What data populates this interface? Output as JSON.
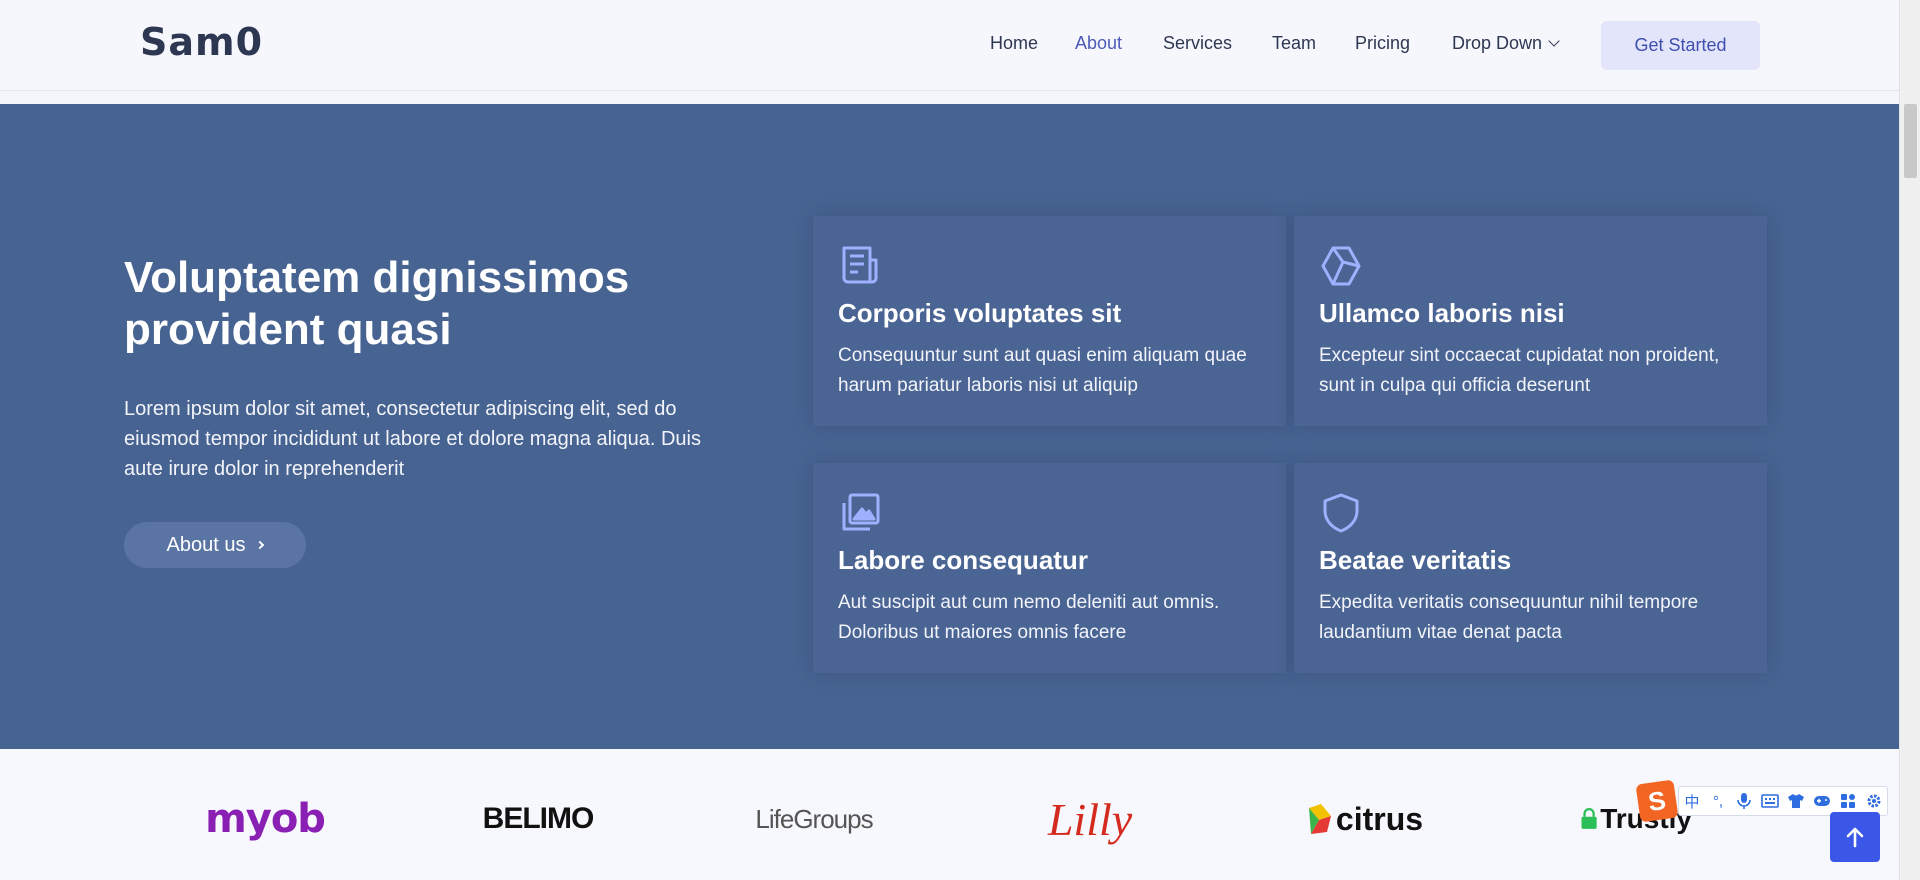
{
  "header": {
    "logo": "Sam0",
    "nav": [
      {
        "label": "Home",
        "active": false
      },
      {
        "label": "About",
        "active": true
      },
      {
        "label": "Services",
        "active": false
      },
      {
        "label": "Team",
        "active": false
      },
      {
        "label": "Pricing",
        "active": false
      },
      {
        "label": "Drop Down",
        "active": false,
        "has_dropdown": true
      }
    ],
    "cta_label": "Get Started"
  },
  "hero": {
    "title": "Voluptatem dignissimos provident quasi",
    "text": "Lorem ipsum dolor sit amet, consectetur adipiscing elit, sed do eiusmod tempor incididunt ut labore et dolore magna aliqua. Duis aute irure dolor in reprehenderit",
    "button_label": "About us"
  },
  "cards": [
    {
      "icon": "newspaper-icon",
      "title": "Corporis voluptates sit",
      "text": "Consequuntur sunt aut quasi enim aliquam quae harum pariatur laboris nisi ut aliquip"
    },
    {
      "icon": "cube-icon",
      "title": "Ullamco laboris nisi",
      "text": "Excepteur sint occaecat cupidatat non proident, sunt in culpa qui officia deserunt"
    },
    {
      "icon": "images-icon",
      "title": "Labore consequatur",
      "text": "Aut suscipit aut cum nemo deleniti aut omnis. Doloribus ut maiores omnis facere"
    },
    {
      "icon": "shield-icon",
      "title": "Beatae veritatis",
      "text": "Expedita veritatis consequuntur nihil tempore laudantium vitae denat pacta"
    }
  ],
  "clients": [
    {
      "name": "myob",
      "color": "#8a1fb3"
    },
    {
      "name": "BELIMO",
      "color": "#111111"
    },
    {
      "name": "LifeGroups",
      "color": "#555555"
    },
    {
      "name": "Lilly",
      "color": "#d52b1e"
    },
    {
      "name": "citrus",
      "color": "#111111"
    },
    {
      "name": "Trustly",
      "color": "#111111"
    }
  ],
  "ime": {
    "logo": "S",
    "items": [
      "中",
      "°,",
      "mic-icon",
      "keyboard-icon",
      "shirt-icon",
      "gamepad-icon",
      "grid-icon",
      "settings-icon"
    ],
    "cn_label": "中",
    "punct_label": "°,"
  },
  "colors": {
    "band": "#476391",
    "accent": "#4b5ab8",
    "back_to_top": "#3a57e8"
  }
}
